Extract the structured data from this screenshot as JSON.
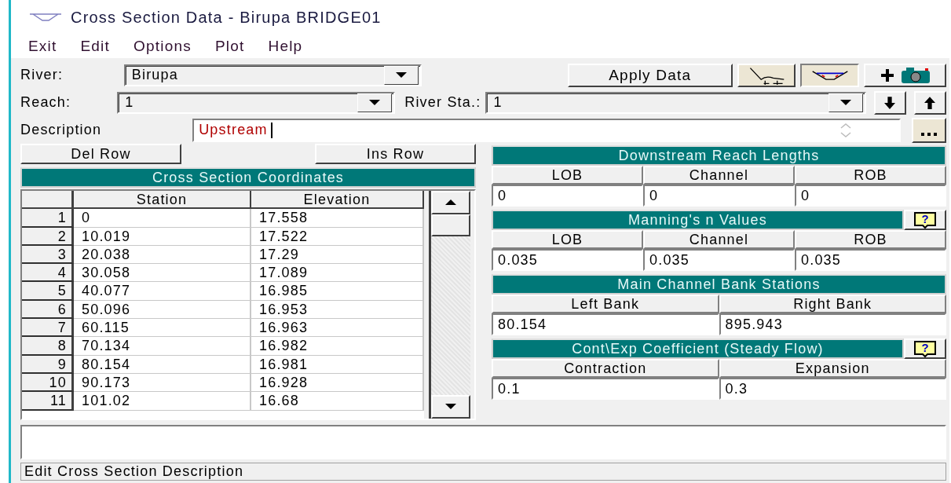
{
  "window": {
    "title": "Cross Section Data - Birupa BRIDGE01"
  },
  "menu": [
    "Exit",
    "Edit",
    "Options",
    "Plot",
    "Help"
  ],
  "river": {
    "label": "River:",
    "value": "Birupa"
  },
  "reach": {
    "label": "Reach:",
    "value": "1"
  },
  "river_sta": {
    "label": "River Sta.:",
    "value": "1"
  },
  "apply_button": "Apply Data",
  "description": {
    "label": "Description",
    "value": "Upstream"
  },
  "del_row": "Del Row",
  "ins_row": "Ins Row",
  "coordinates": {
    "title": "Cross Section Coordinates",
    "columns": [
      "Station",
      "Elevation"
    ],
    "rows": [
      {
        "n": "1",
        "station": "0",
        "elevation": "17.558"
      },
      {
        "n": "2",
        "station": "10.019",
        "elevation": "17.522"
      },
      {
        "n": "3",
        "station": "20.038",
        "elevation": "17.29"
      },
      {
        "n": "4",
        "station": "30.058",
        "elevation": "17.089"
      },
      {
        "n": "5",
        "station": "40.077",
        "elevation": "16.985"
      },
      {
        "n": "6",
        "station": "50.096",
        "elevation": "16.953"
      },
      {
        "n": "7",
        "station": "60.115",
        "elevation": "16.963"
      },
      {
        "n": "8",
        "station": "70.134",
        "elevation": "16.982"
      },
      {
        "n": "9",
        "station": "80.154",
        "elevation": "16.981"
      },
      {
        "n": "10",
        "station": "90.173",
        "elevation": "16.928"
      },
      {
        "n": "11",
        "station": "101.02",
        "elevation": "16.68"
      }
    ]
  },
  "sections": [
    {
      "title": "Downstream Reach Lengths",
      "columns": [
        "LOB",
        "Channel",
        "ROB"
      ],
      "values": [
        "0",
        "0",
        "0"
      ]
    },
    {
      "title": "Manning's n Values",
      "help": "?",
      "columns": [
        "LOB",
        "Channel",
        "ROB"
      ],
      "values": [
        "0.035",
        "0.035",
        "0.035"
      ]
    },
    {
      "title": "Main Channel Bank Stations",
      "columns": [
        "Left Bank",
        "Right Bank"
      ],
      "values": [
        "80.154",
        "895.943"
      ]
    },
    {
      "title": "Cont\\Exp Coefficient (Steady Flow)",
      "help": "?",
      "columns": [
        "Contraction",
        "Expansion"
      ],
      "values": [
        "0.1",
        "0.3"
      ]
    }
  ],
  "status_bar": "Edit Cross Section Description"
}
